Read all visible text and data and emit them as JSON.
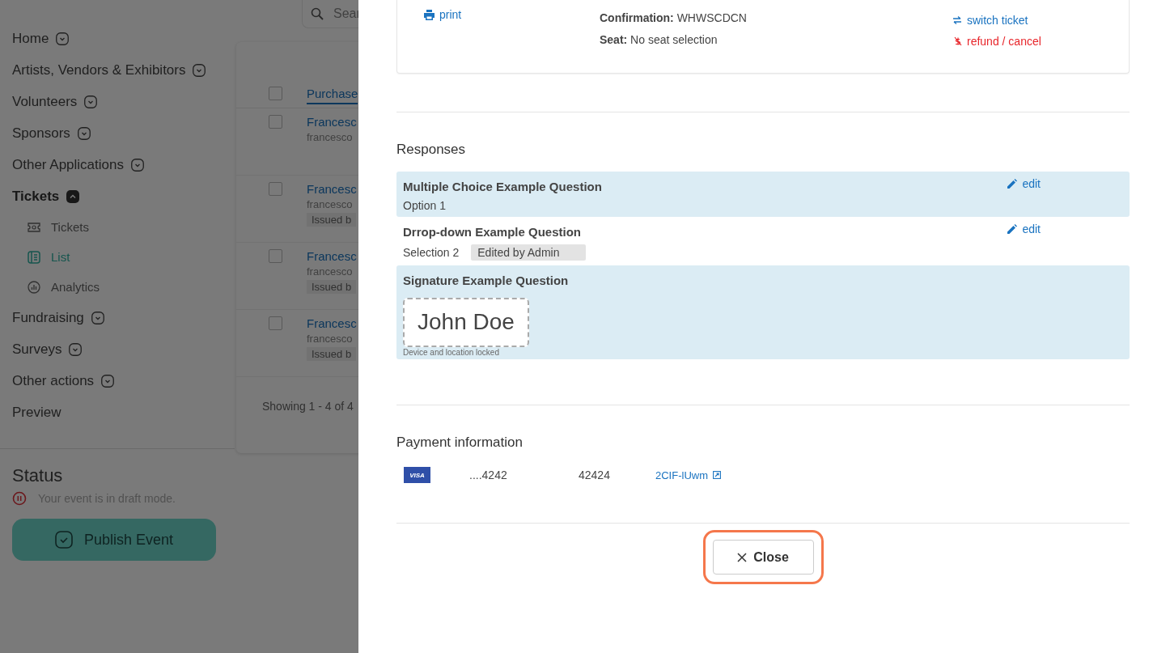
{
  "sidebar": {
    "nav": [
      {
        "label": "Home",
        "kind": "menu",
        "expanded": false
      },
      {
        "label": "Artists, Vendors & Exhibitors",
        "kind": "menu",
        "expanded": false
      },
      {
        "label": "Volunteers",
        "kind": "menu",
        "expanded": false
      },
      {
        "label": "Sponsors",
        "kind": "menu",
        "expanded": false
      },
      {
        "label": "Other Applications",
        "kind": "menu",
        "expanded": false
      },
      {
        "label": "Tickets",
        "kind": "menu",
        "expanded": true,
        "children": [
          {
            "label": "Tickets",
            "selected": false
          },
          {
            "label": "List",
            "selected": true
          },
          {
            "label": "Analytics",
            "selected": false
          }
        ]
      },
      {
        "label": "Fundraising",
        "kind": "menu",
        "expanded": false
      },
      {
        "label": "Surveys",
        "kind": "menu",
        "expanded": false
      },
      {
        "label": "Other actions",
        "kind": "menu",
        "expanded": false
      },
      {
        "label": "Preview",
        "kind": "link"
      }
    ],
    "status": {
      "title": "Status",
      "message": "Your event is in draft mode."
    },
    "publish_button": "Publish Event"
  },
  "main": {
    "search": {
      "placeholder": "Sear"
    },
    "table": {
      "header": "Purchase",
      "all_checked": false,
      "rows": [
        {
          "checked": false,
          "name": "Francesc",
          "email": "francesco"
        },
        {
          "checked": false,
          "name": "Francesc",
          "email": "francesco",
          "badge": "Issued b"
        },
        {
          "checked": false,
          "name": "Francesc",
          "email": "francesco",
          "badge": "Issued b"
        },
        {
          "checked": false,
          "name": "Francesc",
          "email": "francesco",
          "badge": "Issued b"
        }
      ],
      "footer": "Showing 1 - 4 of 4"
    }
  },
  "modal": {
    "ticket": {
      "print": "print",
      "fields": [
        {
          "label": "Confirmation:",
          "value": "WHWSCDCN"
        },
        {
          "label": "Seat:",
          "value": "No seat selection"
        }
      ],
      "actions": [
        {
          "label": "switch ticket",
          "kind": "switch"
        },
        {
          "label": "refund / cancel",
          "kind": "refund"
        }
      ]
    },
    "responses": {
      "title": "Responses",
      "items": [
        {
          "kind": "text",
          "question": "Multiple Choice Example Question",
          "answer": "Option 1",
          "edit": "edit"
        },
        {
          "kind": "text",
          "question": "Drrop-down Example Question",
          "answer": "Selection 2",
          "note": "Edited by Admin",
          "edit": "edit"
        },
        {
          "kind": "signature",
          "question": "Signature Example Question",
          "signature": "John Doe",
          "caption": "Device and location locked"
        }
      ]
    },
    "payment": {
      "title": "Payment information",
      "card_brand": "VISA",
      "card_number": "....4242",
      "postal_code": "42424",
      "reference": "2CIF-lUwm"
    },
    "close_button": {
      "label": "Close",
      "highlighted": true
    }
  }
}
